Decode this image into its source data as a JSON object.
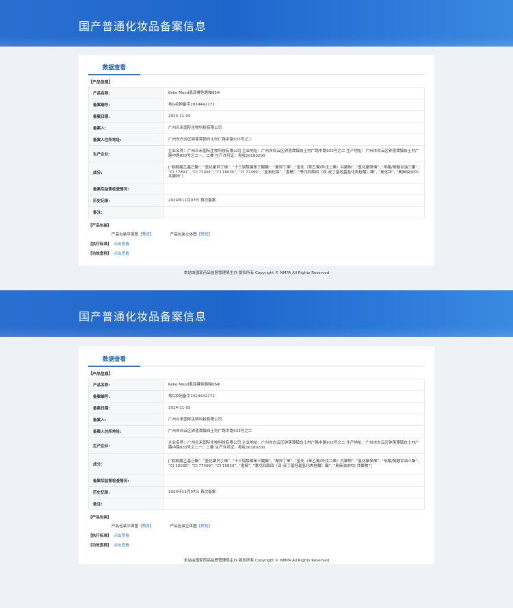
{
  "records": [
    {
      "banner_title": "国产普通化妆品备案信息",
      "tab_label": "数据查看",
      "group_product_info": "【产品信息】",
      "rows": [
        {
          "label": "产品名称:",
          "value": "Keke Mood混润裸色唇釉05#"
        },
        {
          "label": "备案编号:",
          "value": "粤G妆网备字2024442271"
        },
        {
          "label": "备案日期:",
          "value": "2024-11-05"
        },
        {
          "label": "备案人:",
          "value": "广州众禾国际生物科技有限公司"
        },
        {
          "label": "备案人住所地址:",
          "value": "广州市白云区钟落潭镇白土村广路中路933号之二"
        },
        {
          "label": "生产企业:",
          "value": "企业名称：广州众禾国际生物科技有限公司 企业地址：广州市白云区钟落潭镇白土村广路中路933号之二 生产地址：广州市白云区钟落潭镇白土村广路中路933号之二一、二楼 生产许可证：粤妆20180200"
        },
        {
          "label": "成分:",
          "value": "[“棕榈酸乙基己酯”, “氢化聚异丁烯”, “十三烷醇偏苯三酸酯”, “聚异丁烯”, “氢化（苯乙烯/异戊二烯）共聚物”, “氢化聚癸烯”, “辛酸/癸酸甘油三酯”, “CI 77891”, “CI 77491”, “CI 16035”, “CI 77499”, “氢氧化铝”, “香精”, “季戊四醇四（双-叔丁基羟基氢化肉桂酸）酯”, “氧化锌”, “奥麻油/IPDI 共聚物”]"
        },
        {
          "label": "备案后监督检查情况:",
          "value": ""
        },
        {
          "label": "历史记录:",
          "value": "2024年11月07日 首次备案"
        },
        {
          "label": "备注:",
          "value": ""
        }
      ],
      "group_packaging": "【产品包装】",
      "pack_flat_label": "产品包装平面图",
      "pack_flat_link": "【预览】",
      "pack_3d_label": "产品包装立体图",
      "pack_3d_link": "【预览】",
      "std_title": "【执行标准】",
      "std_link": "点击查看",
      "eff_title": "【功效宣称】",
      "eff_link": "点击查看",
      "footer": "本站由国家药品监督管理局主办 版权所有 Copyright © NMPA All Rights Reserved"
    },
    {
      "banner_title": "国产普通化妆品备案信息",
      "tab_label": "数据查看",
      "group_product_info": "【产品信息】",
      "rows": [
        {
          "label": "产品名称:",
          "value": "Keke Mood混润裸色唇釉06#"
        },
        {
          "label": "备案编号:",
          "value": "粤G妆网备字2024442272"
        },
        {
          "label": "备案日期:",
          "value": "2024-11-05"
        },
        {
          "label": "备案人:",
          "value": "广州众禾国际生物科技有限公司"
        },
        {
          "label": "备案人住所地址:",
          "value": "广州市白云区钟落潭镇白土村广路中路933号之二"
        },
        {
          "label": "生产企业:",
          "value": "企业名称：广州众禾国际生物科技有限公司 企业地址：广州市白云区钟落潭镇白土村广路中路933号之二 生产地址：广州市白云区钟落潭镇白土村广路中路933号之二一、二楼 生产许可证：粤妆20180200"
        },
        {
          "label": "成分:",
          "value": "[“棕榈酸乙基己酯”, “氢化聚异丁烯”, “十三烷醇偏苯三酸酯”, “聚异丁烯”, “氢化（苯乙烯/异戊二烯）共聚物”, “氢化聚癸烯”, “辛酸/癸酸甘油三酯”, “CI 16035”, “CI 77499”, “CI 15850”, “香精”, “季戊四醇四（双-叔丁基羟基氢化肉桂酸）酯”, “奥麻油/IPDI 共聚物”]"
        },
        {
          "label": "备案后监督检查情况:",
          "value": ""
        },
        {
          "label": "历史记录:",
          "value": "2024年11月07日 首次备案"
        },
        {
          "label": "备注:",
          "value": ""
        }
      ],
      "group_packaging": "【产品包装】",
      "pack_flat_label": "产品包装平面图",
      "pack_flat_link": "【预览】",
      "pack_3d_label": "产品包装立体图",
      "pack_3d_link": "【预览】",
      "std_title": "【执行标准】",
      "std_link": "点击查看",
      "eff_title": "【功效宣称】",
      "eff_link": "点击查看",
      "footer": "本站由国家药品监督管理局主办 版权所有 Copyright © NMPA All Rights Reserved"
    }
  ]
}
